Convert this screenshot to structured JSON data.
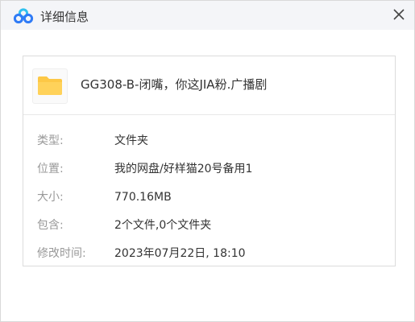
{
  "window": {
    "title": "详细信息",
    "logo_icon": "baidu-netdisk-cloud-icon",
    "close_icon": "close-icon"
  },
  "file": {
    "icon": "folder-icon",
    "icon_color": "#fdc846",
    "name": "GG308-B-闭嘴，你这JIA粉.广播剧"
  },
  "details": [
    {
      "label": "类型:",
      "value": "文件夹"
    },
    {
      "label": "位置:",
      "value": "我的网盘/好样猫20号备用1"
    },
    {
      "label": "大小:",
      "value": "770.16MB"
    },
    {
      "label": "包含:",
      "value": "2个文件,0个文件夹"
    },
    {
      "label": "修改时间:",
      "value": "2023年07月22日, 18:10"
    }
  ],
  "colors": {
    "titlebar_bg": "#f4f5f8",
    "label_text": "#999999",
    "value_text": "#333333",
    "logo_blue": "#2f7bf6",
    "logo_cyan": "#2fc0ee"
  }
}
